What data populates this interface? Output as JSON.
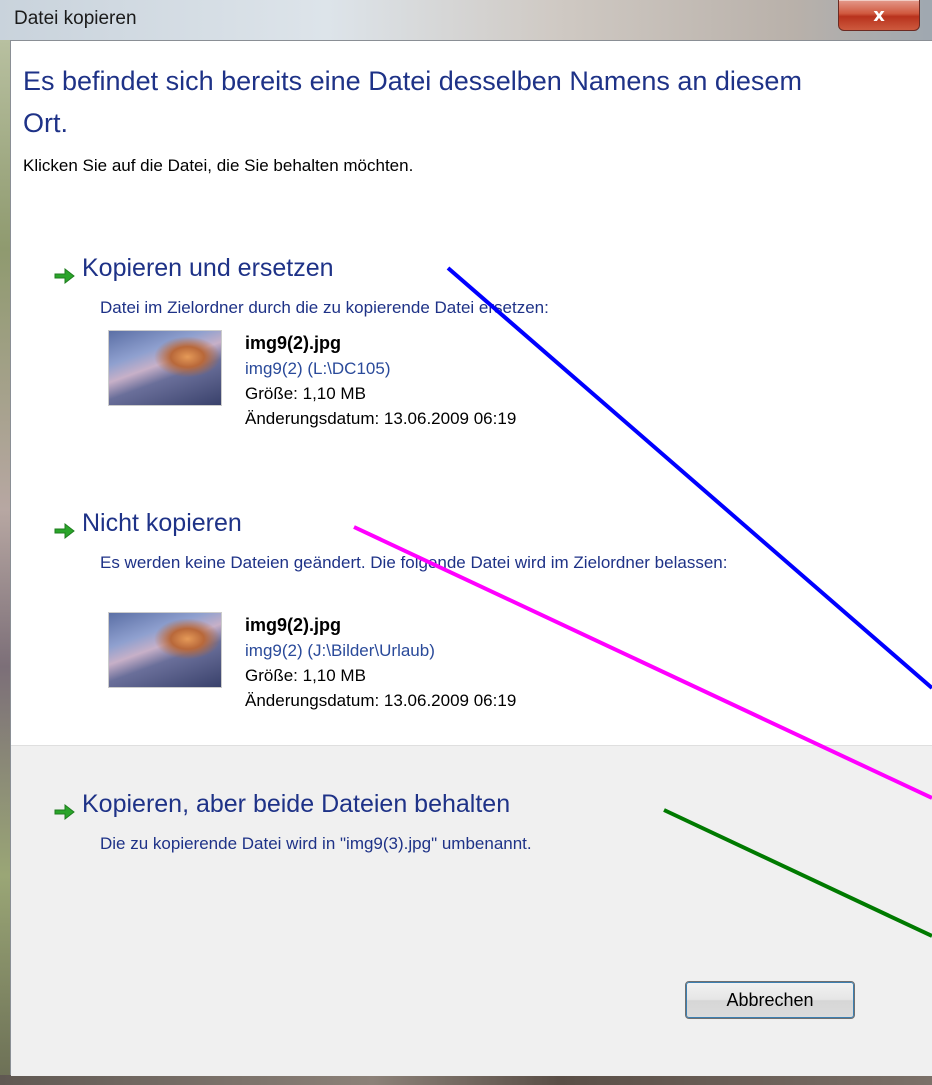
{
  "window": {
    "title": "Datei kopieren",
    "close_label": "x"
  },
  "dialog": {
    "heading": "Es befindet sich bereits eine Datei desselben Namens an diesem Ort.",
    "instruction": "Klicken Sie auf die Datei, die Sie behalten möchten."
  },
  "options": [
    {
      "title": "Kopieren und ersetzen",
      "description": "Datei im Zielordner durch die zu kopierende Datei ersetzen:",
      "file": {
        "name": "img9(2).jpg",
        "path": "img9(2) (L:\\DC105)",
        "size": "Größe: 1,10 MB",
        "modified": "Änderungsdatum: 13.06.2009 06:19"
      }
    },
    {
      "title": "Nicht kopieren",
      "description": "Es werden keine Dateien geändert. Die folgende Datei wird im Zielordner belassen:",
      "file": {
        "name": "img9(2).jpg",
        "path": "img9(2) (J:\\Bilder\\Urlaub)",
        "size": "Größe: 1,10 MB",
        "modified": "Änderungsdatum: 13.06.2009 06:19"
      }
    },
    {
      "title": "Kopieren, aber beide Dateien behalten",
      "description": "Die zu kopierende Datei wird in \"img9(3).jpg\" umbenannt."
    }
  ],
  "buttons": {
    "cancel": "Abbrechen"
  },
  "colors": {
    "heading": "#1e3287",
    "arrow": "#2aa52a",
    "annotation_blue": "#0000ff",
    "annotation_magenta": "#ff00ff",
    "annotation_green": "#007a00"
  }
}
